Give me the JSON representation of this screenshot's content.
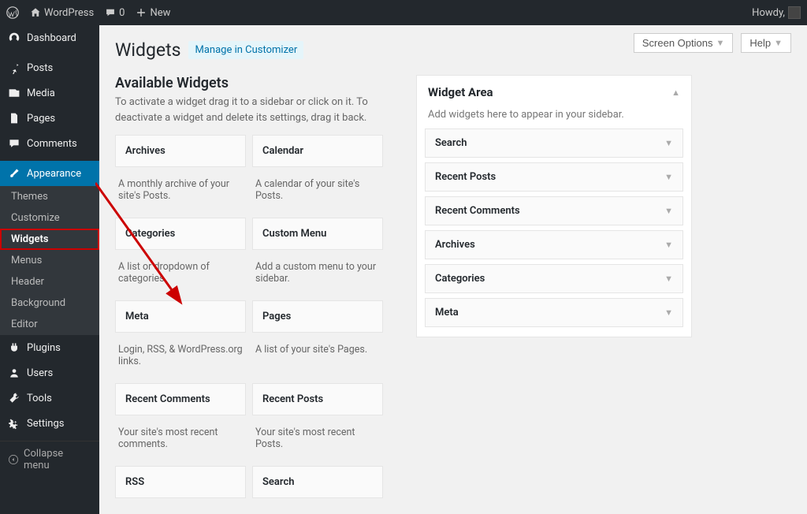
{
  "adminbar": {
    "site_name": "WordPress",
    "comments_count": "0",
    "new_label": "New",
    "howdy": "Howdy,"
  },
  "sidebar": {
    "dashboard": "Dashboard",
    "posts": "Posts",
    "media": "Media",
    "pages": "Pages",
    "comments": "Comments",
    "appearance": "Appearance",
    "appearance_sub": {
      "themes": "Themes",
      "customize": "Customize",
      "widgets": "Widgets",
      "menus": "Menus",
      "header": "Header",
      "background": "Background",
      "editor": "Editor"
    },
    "plugins": "Plugins",
    "users": "Users",
    "tools": "Tools",
    "settings": "Settings",
    "collapse": "Collapse menu"
  },
  "topright": {
    "screen_options": "Screen Options",
    "help": "Help"
  },
  "page": {
    "title": "Widgets",
    "customizer_link": "Manage in Customizer",
    "available_title": "Available Widgets",
    "available_help": "To activate a widget drag it to a sidebar or click on it. To deactivate a widget and delete its settings, drag it back."
  },
  "available_widgets": [
    {
      "title": "Archives",
      "desc": "A monthly archive of your site's Posts."
    },
    {
      "title": "Calendar",
      "desc": "A calendar of your site's Posts."
    },
    {
      "title": "Categories",
      "desc": "A list or dropdown of categories."
    },
    {
      "title": "Custom Menu",
      "desc": "Add a custom menu to your sidebar."
    },
    {
      "title": "Meta",
      "desc": "Login, RSS, & WordPress.org links."
    },
    {
      "title": "Pages",
      "desc": "A list of your site's Pages."
    },
    {
      "title": "Recent Comments",
      "desc": "Your site's most recent comments."
    },
    {
      "title": "Recent Posts",
      "desc": "Your site's most recent Posts."
    },
    {
      "title": "RSS",
      "desc": ""
    },
    {
      "title": "Search",
      "desc": ""
    }
  ],
  "widget_area": {
    "title": "Widget Area",
    "hint": "Add widgets here to appear in your sidebar.",
    "items": [
      "Search",
      "Recent Posts",
      "Recent Comments",
      "Archives",
      "Categories",
      "Meta"
    ]
  }
}
